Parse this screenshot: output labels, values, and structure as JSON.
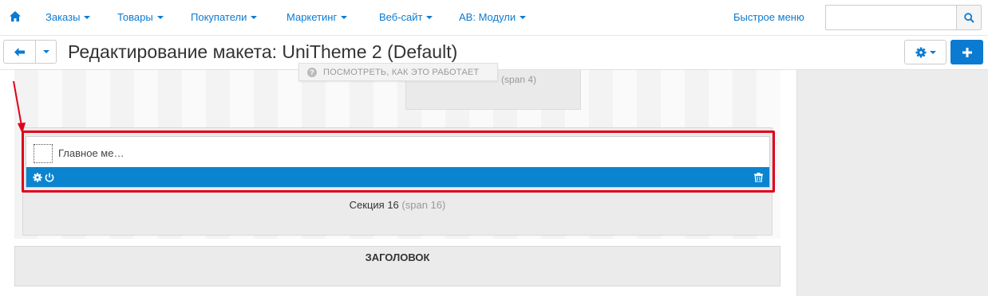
{
  "nav": {
    "items": [
      {
        "label": "Заказы"
      },
      {
        "label": "Товары"
      },
      {
        "label": "Покупатели"
      },
      {
        "label": "Маркетинг"
      },
      {
        "label": "Веб-сайт"
      },
      {
        "label": "AB: Модули"
      }
    ],
    "quick_menu": "Быстрое меню",
    "search": {
      "value": "",
      "placeholder": ""
    }
  },
  "toolbar": {
    "title": "Редактирование макета: UniTheme 2 (Default)"
  },
  "tooltip": {
    "text": "ПОСМОТРЕТЬ, КАК ЭТО РАБОТАЕТ"
  },
  "layout": {
    "top_block_span": "(span 4)",
    "block_name": "Главное ме…",
    "section_name": "Секция 16",
    "section_span": "(span 16)",
    "header_section": "ЗАГОЛОВОК"
  },
  "colors": {
    "accent": "#0b7ad1",
    "block_bar": "#0b84d0",
    "highlight": "#e1001a"
  }
}
